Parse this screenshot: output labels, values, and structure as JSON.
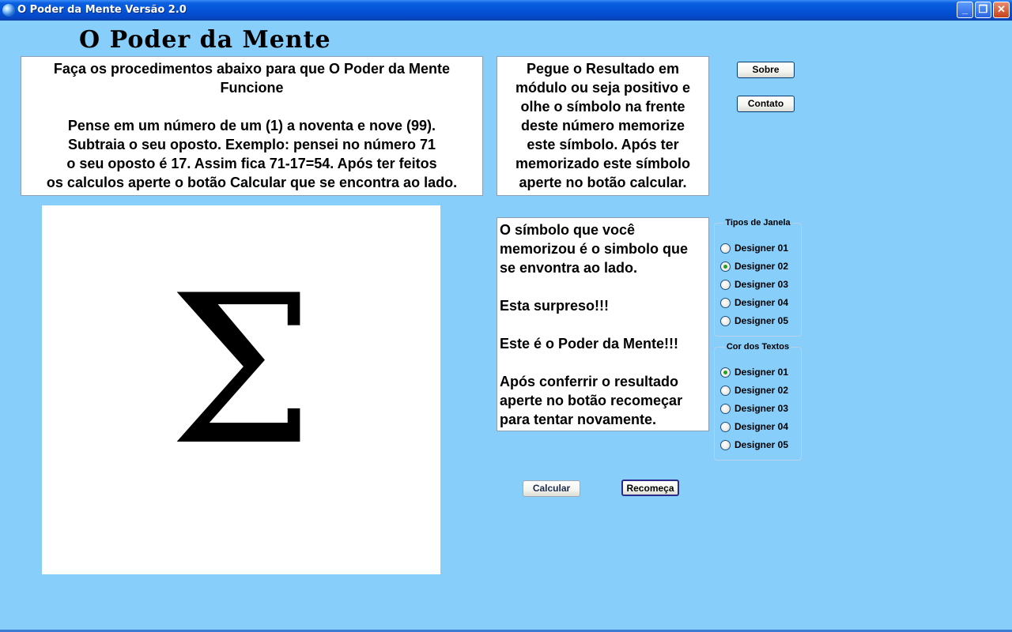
{
  "window": {
    "title": "O Poder da Mente Versão 2.0"
  },
  "app": {
    "heading": "O Poder da Mente"
  },
  "instructions": {
    "line1": "Faça os procedimentos abaixo para que O Poder da Mente",
    "line2": "Funcione",
    "line3": "Pense em um número de um (1) a noventa e nove (99).",
    "line4": "Subtraia o seu oposto. Exemplo: pensei no número 71",
    "line5": "o seu oposto é 17. Assim fica 71-17=54. Após ter feitos",
    "line6": "os calculos aperte o botão Calcular que se encontra ao lado."
  },
  "instructions2": {
    "line1": "Pegue o Resultado em",
    "line2": "módulo ou seja positivo e",
    "line3": "olhe o símbolo na frente",
    "line4": "deste número memorize",
    "line5": "este símbolo. Após ter",
    "line6": "memorizado este símbolo",
    "line7": "aperte no botão calcular."
  },
  "symbol": {
    "glyph": "Σ"
  },
  "result": {
    "line1": "O símbolo que você",
    "line2": "memorizou é o simbolo que",
    "line3": "se envontra ao lado.",
    "line4": "Esta surpreso!!!",
    "line5": "Este é o Poder da Mente!!!",
    "line6": "Após conferrir o resultado",
    "line7": "aperte no botão recomeçar",
    "line8": "para tentar novamente."
  },
  "buttons": {
    "sobre": "Sobre",
    "contato": "Contato",
    "calcular": "Calcular",
    "recomeca": "Recomeça"
  },
  "window_types": {
    "title": "Tipos de Janela",
    "options": [
      "Designer 01",
      "Designer 02",
      "Designer 03",
      "Designer 04",
      "Designer 05"
    ],
    "selected": "Designer 02"
  },
  "text_colors": {
    "title": "Cor dos Textos",
    "options": [
      "Designer 01",
      "Designer 02",
      "Designer 03",
      "Designer 04",
      "Designer 05"
    ],
    "selected": "Designer 01"
  },
  "colors": {
    "background": "#87cefa",
    "titlebar": "#0554d8",
    "radio_checked": "#21a121"
  }
}
